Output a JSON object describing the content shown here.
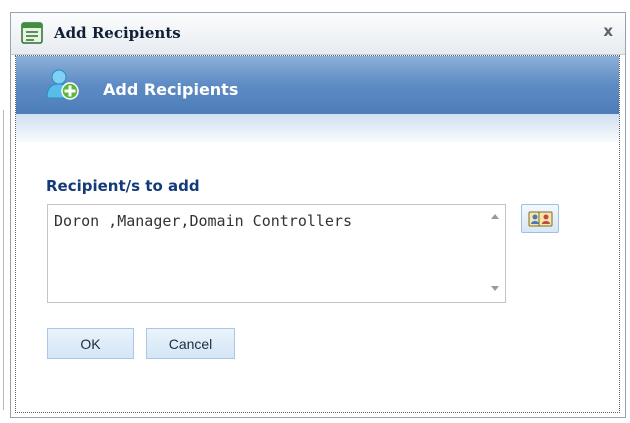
{
  "window": {
    "title": "Add Recipients",
    "close_glyph": "x",
    "app_icon": "form-window-icon"
  },
  "banner": {
    "title": "Add Recipients",
    "icon": "user-add-icon"
  },
  "form": {
    "label": "Recipient/s to add",
    "recipients_value": "Doron ,Manager,Domain Controllers",
    "address_book_icon": "address-book-icon"
  },
  "buttons": {
    "ok_label": "OK",
    "cancel_label": "Cancel"
  },
  "colors": {
    "banner_blue": "#5d8bc4",
    "label_blue": "#133a7a",
    "button_border": "#a9c7e6"
  }
}
